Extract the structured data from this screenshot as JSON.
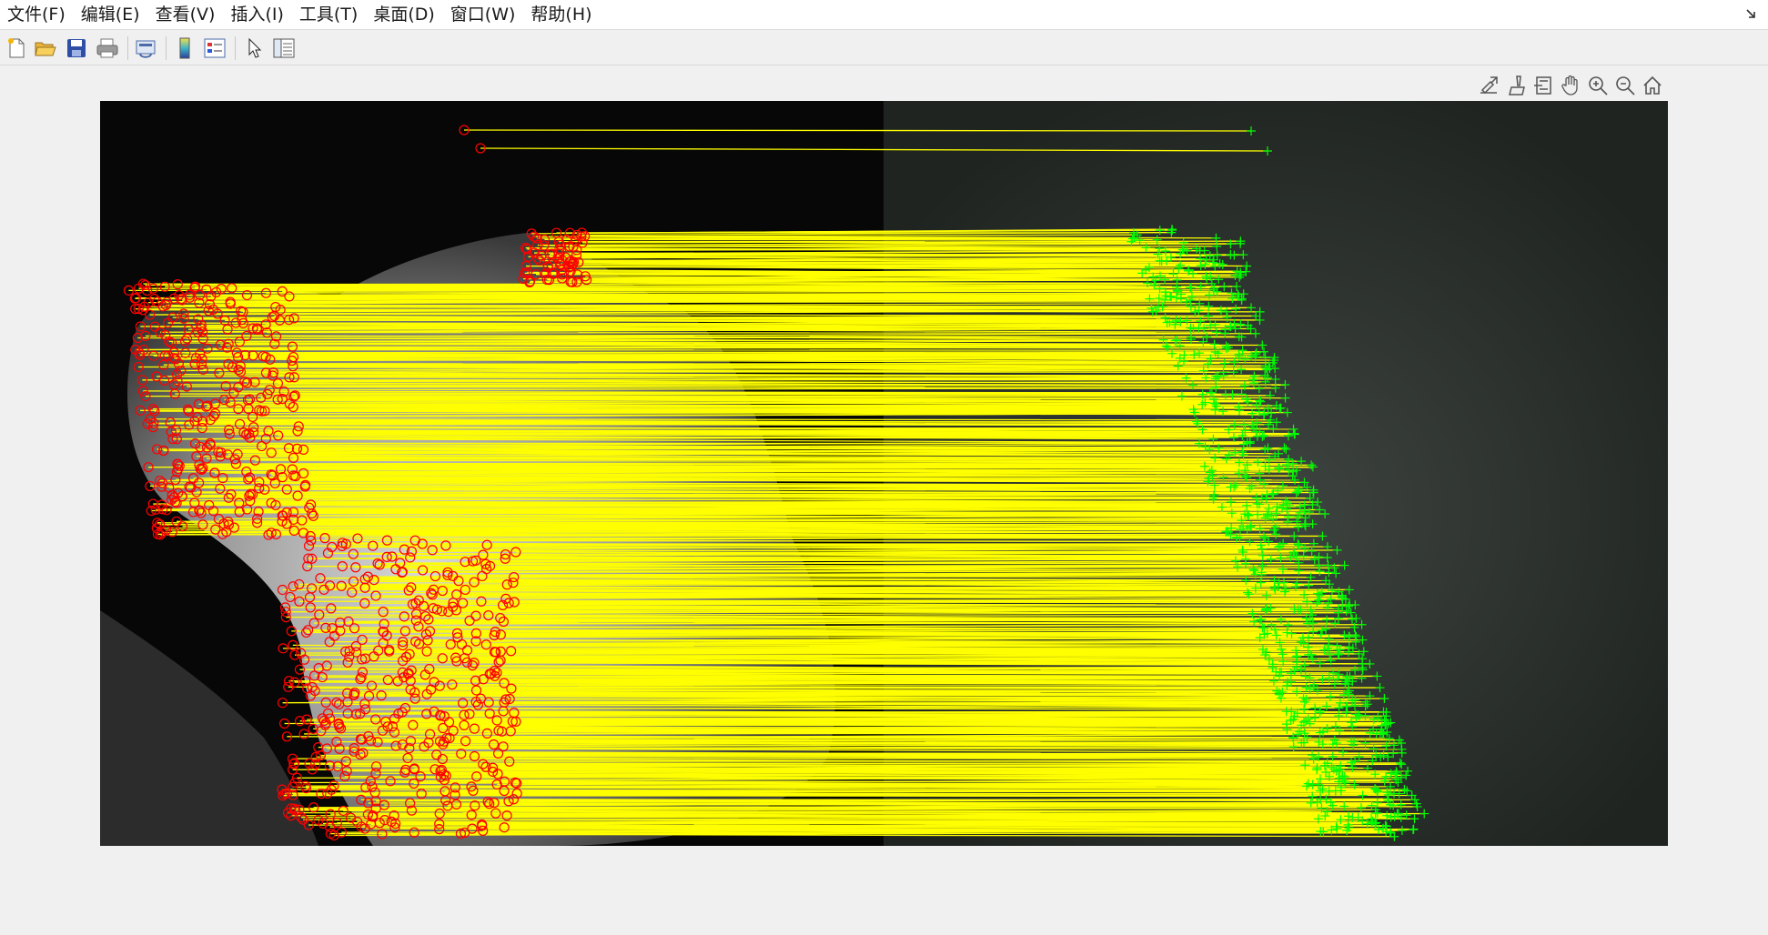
{
  "menu": [
    {
      "label": "文件(F)"
    },
    {
      "label": "编辑(E)"
    },
    {
      "label": "查看(V)"
    },
    {
      "label": "插入(I)"
    },
    {
      "label": "工具(T)"
    },
    {
      "label": "桌面(D)"
    },
    {
      "label": "窗口(W)"
    },
    {
      "label": "帮助(H)"
    }
  ],
  "toolbar": {
    "icons": [
      "new-figure-icon",
      "open-file-icon",
      "save-icon",
      "print-icon",
      "link-plot-icon",
      "colorbar-icon",
      "legend-icon",
      "select-pointer-icon",
      "property-inspector-icon"
    ]
  },
  "axes_toolbar": {
    "icons": [
      "export-icon",
      "data-tips-icon",
      "brush-icon",
      "pan-icon",
      "zoom-in-icon",
      "zoom-out-icon",
      "home-icon"
    ]
  },
  "figure": {
    "description_colors": {
      "marker_left": "#ff0000",
      "marker_right": "#00ff00",
      "match_line": "#ffff00"
    }
  }
}
